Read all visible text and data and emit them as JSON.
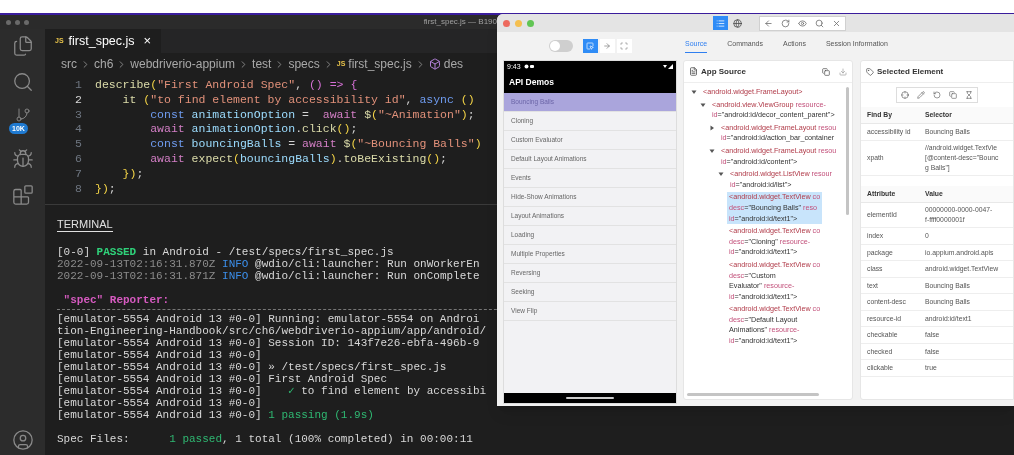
{
  "vscode": {
    "title": "first_spec.js — B190",
    "source_control_badge": "10K",
    "tab": {
      "file_icon": "JS",
      "label": "first_spec.js",
      "close": "×",
      "selected": true
    },
    "breadcrumb": [
      {
        "label": "src",
        "kind": "folder"
      },
      {
        "label": "ch6",
        "kind": "folder"
      },
      {
        "label": "webdriverio-appium",
        "kind": "folder"
      },
      {
        "label": "test",
        "kind": "folder"
      },
      {
        "label": "specs",
        "kind": "folder"
      },
      {
        "label": "first_spec.js",
        "kind": "file",
        "icon_text": "JS"
      },
      {
        "label": "des",
        "kind": "symbol"
      }
    ],
    "code": [
      {
        "number": "1",
        "current": false,
        "tokens": [
          {
            "text": "describe",
            "kind": "fn"
          },
          {
            "text": "(",
            "kind": "br"
          },
          {
            "text": "\"First Android Spec\"",
            "kind": "str"
          },
          {
            "text": ", ",
            "kind": "p"
          },
          {
            "text": "() => {",
            "kind": "arrow"
          }
        ]
      },
      {
        "number": "2",
        "current": true,
        "tokens": [
          {
            "text": "    it",
            "kind": "fn"
          },
          {
            "text": " (",
            "kind": "br"
          },
          {
            "text": "\"to find element by accessibility id\"",
            "kind": "str"
          },
          {
            "text": ", ",
            "kind": "p"
          },
          {
            "text": "async",
            "kind": "kw"
          },
          {
            "text": " ()",
            "kind": "br"
          }
        ]
      },
      {
        "number": "3",
        "current": false,
        "tokens": [
          {
            "text": "        const",
            "kind": "kw"
          },
          {
            "text": " animationOption",
            "kind": "var"
          },
          {
            "text": " =  ",
            "kind": "p"
          },
          {
            "text": "await",
            "kind": "aw"
          },
          {
            "text": " $",
            "kind": "fn"
          },
          {
            "text": "(",
            "kind": "br"
          },
          {
            "text": "\"~Animation\"",
            "kind": "str"
          },
          {
            "text": ")",
            "kind": "br"
          },
          {
            "text": ";",
            "kind": "p"
          }
        ]
      },
      {
        "number": "4",
        "current": false,
        "tokens": [
          {
            "text": "        await",
            "kind": "aw"
          },
          {
            "text": " animationOption",
            "kind": "var"
          },
          {
            "text": ".",
            "kind": "p"
          },
          {
            "text": "click",
            "kind": "fn"
          },
          {
            "text": "()",
            "kind": "br"
          },
          {
            "text": ";",
            "kind": "p"
          }
        ]
      },
      {
        "number": "5",
        "current": false,
        "tokens": [
          {
            "text": "        const",
            "kind": "kw"
          },
          {
            "text": " bouncingBalls",
            "kind": "var"
          },
          {
            "text": " = ",
            "kind": "p"
          },
          {
            "text": "await",
            "kind": "aw"
          },
          {
            "text": " $",
            "kind": "fn"
          },
          {
            "text": "(",
            "kind": "br"
          },
          {
            "text": "\"~Bouncing Balls\"",
            "kind": "str"
          },
          {
            "text": ")",
            "kind": "br"
          }
        ]
      },
      {
        "number": "6",
        "current": false,
        "tokens": [
          {
            "text": "        await",
            "kind": "aw"
          },
          {
            "text": " expect",
            "kind": "fn"
          },
          {
            "text": "(",
            "kind": "br"
          },
          {
            "text": "bouncingBalls",
            "kind": "var"
          },
          {
            "text": ")",
            "kind": "br"
          },
          {
            "text": ".",
            "kind": "p"
          },
          {
            "text": "toBeExisting",
            "kind": "fn"
          },
          {
            "text": "()",
            "kind": "br"
          },
          {
            "text": ";",
            "kind": "p"
          }
        ]
      },
      {
        "number": "7",
        "current": false,
        "tokens": [
          {
            "text": "    })",
            "kind": "br"
          },
          {
            "text": ";",
            "kind": "p"
          }
        ]
      },
      {
        "number": "8",
        "current": false,
        "tokens": [
          {
            "text": "})",
            "kind": "br"
          },
          {
            "text": ";",
            "kind": "p"
          }
        ]
      }
    ],
    "panel_title": "TERMINAL",
    "terminal": [
      {
        "lines": [
          [
            {
              "text": "[0-0] ",
              "kind": "plain"
            },
            {
              "text": "PASSED",
              "kind": "pass"
            },
            {
              "text": " in Android - /test/specs/first_spec.js",
              "kind": "plain"
            }
          ],
          [
            {
              "text": "2022-09-13T02:16:31.870Z",
              "kind": "dim"
            },
            {
              "text": " INFO",
              "kind": "info"
            },
            {
              "text": " @wdio/cli:launcher: Run onWorkerEn",
              "kind": "plain"
            }
          ],
          [
            {
              "text": "2022-09-13T02:16:31.871Z",
              "kind": "dim"
            },
            {
              "text": " INFO",
              "kind": "info"
            },
            {
              "text": " @wdio/cli:launcher: Run onComplete",
              "kind": "plain"
            }
          ]
        ]
      },
      {
        "title": " \"spec\" Reporter:",
        "lines": [
          [
            {
              "text": "[emulator-5554 Android 13 #0-0] Running: emulator-5554 on Androi",
              "kind": "plain"
            }
          ],
          [
            {
              "text": "tion-Engineering-Handbook/src/ch6/webdriverio-appium/app/android/",
              "kind": "plain"
            }
          ],
          [
            {
              "text": "[emulator-5554 Android 13 #0-0] Session ID: 143f7e26-ebfa-496b-9",
              "kind": "plain"
            }
          ],
          [
            {
              "text": "[emulator-5554 Android 13 #0-0]",
              "kind": "plain"
            }
          ],
          [
            {
              "text": "[emulator-5554 Android 13 #0-0] » /test/specs/first_spec.js",
              "kind": "plain"
            }
          ],
          [
            {
              "text": "[emulator-5554 Android 13 #0-0] First Android Spec",
              "kind": "plain"
            }
          ],
          [
            {
              "text": "[emulator-5554 Android 13 #0-0]    ",
              "kind": "plain"
            },
            {
              "text": "✓",
              "kind": "ok"
            },
            {
              "text": " to find element by accessibi",
              "kind": "plain"
            }
          ],
          [
            {
              "text": "[emulator-5554 Android 13 #0-0]",
              "kind": "plain"
            }
          ],
          [
            {
              "text": "[emulator-5554 Android 13 #0-0] ",
              "kind": "plain"
            },
            {
              "text": "1 passing (1.9s)",
              "kind": "ok"
            }
          ]
        ]
      },
      {
        "lines": [
          [
            {
              "text": "Spec Files:      ",
              "kind": "plain"
            },
            {
              "text": "1 passed",
              "kind": "ok"
            },
            {
              "text": ", 1 total (100% completed) in 00:00:11",
              "kind": "plain"
            }
          ]
        ]
      }
    ]
  },
  "inspector": {
    "app_modes": [
      {
        "selected": true
      },
      {
        "selected": false
      }
    ],
    "toggle_on": false,
    "interaction_modes": [
      {
        "selected": true
      },
      {
        "selected": false
      },
      {
        "selected": false
      }
    ],
    "device": {
      "time": "9:43",
      "app_title": "API Demos",
      "items": [
        {
          "label": "Bouncing Balls",
          "selected": true
        },
        {
          "label": "Cloning",
          "selected": false
        },
        {
          "label": "Custom Evaluator",
          "selected": false
        },
        {
          "label": "Default Layout Animations",
          "selected": false
        },
        {
          "label": "Events",
          "selected": false
        },
        {
          "label": "Hide-Show Animations",
          "selected": false
        },
        {
          "label": "Layout Animations",
          "selected": false
        },
        {
          "label": "Loading",
          "selected": false
        },
        {
          "label": "Multiple Properties",
          "selected": false
        },
        {
          "label": "Reversing",
          "selected": false
        },
        {
          "label": "Seeking",
          "selected": false
        },
        {
          "label": "View Flip",
          "selected": false
        }
      ]
    },
    "tabs": [
      {
        "label": "Source",
        "selected": true
      },
      {
        "label": "Commands",
        "selected": false
      },
      {
        "label": "Actions",
        "selected": false
      },
      {
        "label": "Session Information",
        "selected": false
      }
    ],
    "source": {
      "title": "App Source",
      "tree": [
        {
          "expanded": true,
          "selected": false,
          "lines": [
            [
              {
                "text": "<android.widget.FrameLayout>",
                "kind": "tag"
              }
            ]
          ],
          "children": [
            {
              "expanded": true,
              "selected": false,
              "lines": [
                [
                  {
                    "text": "<android.view.ViewGroup",
                    "kind": "tag"
                  },
                  {
                    "text": " resource-",
                    "kind": "attr"
                  }
                ],
                [
                  {
                    "text": "id",
                    "kind": "attr"
                  },
                  {
                    "text": "=\"android:id/decor_content_parent\">",
                    "kind": "val"
                  }
                ]
              ],
              "children": [
                {
                  "expanded": false,
                  "selected": false,
                  "lines": [
                    [
                      {
                        "text": "<android.widget.FrameLayout",
                        "kind": "tag"
                      },
                      {
                        "text": " resou",
                        "kind": "attr"
                      }
                    ],
                    [
                      {
                        "text": "id",
                        "kind": "attr"
                      },
                      {
                        "text": "=\"android:id/action_bar_container",
                        "kind": "val"
                      }
                    ]
                  ]
                },
                {
                  "expanded": true,
                  "selected": false,
                  "lines": [
                    [
                      {
                        "text": "<android.widget.FrameLayout",
                        "kind": "tag"
                      },
                      {
                        "text": " resou",
                        "kind": "attr"
                      }
                    ],
                    [
                      {
                        "text": "id",
                        "kind": "attr"
                      },
                      {
                        "text": "=\"android:id/content\">",
                        "kind": "val"
                      }
                    ]
                  ],
                  "children": [
                    {
                      "expanded": true,
                      "selected": false,
                      "lines": [
                        [
                          {
                            "text": "<android.widget.ListView",
                            "kind": "tag"
                          },
                          {
                            "text": " resour",
                            "kind": "attr"
                          }
                        ],
                        [
                          {
                            "text": "id",
                            "kind": "attr"
                          },
                          {
                            "text": "=\"android:id/list\">",
                            "kind": "val"
                          }
                        ]
                      ],
                      "children": [
                        {
                          "selected": true,
                          "lines": [
                            [
                              {
                                "text": "<android.widget.TextView",
                                "kind": "tag"
                              },
                              {
                                "text": " co",
                                "kind": "attr"
                              }
                            ],
                            [
                              {
                                "text": "desc",
                                "kind": "attr"
                              },
                              {
                                "text": "=\"Bouncing Balls\"",
                                "kind": "val"
                              },
                              {
                                "text": " reso",
                                "kind": "attr"
                              }
                            ],
                            [
                              {
                                "text": "id",
                                "kind": "attr"
                              },
                              {
                                "text": "=\"android:id/text1\">",
                                "kind": "val"
                              }
                            ]
                          ]
                        },
                        {
                          "selected": false,
                          "lines": [
                            [
                              {
                                "text": "<android.widget.TextView",
                                "kind": "tag"
                              },
                              {
                                "text": " co",
                                "kind": "attr"
                              }
                            ],
                            [
                              {
                                "text": "desc",
                                "kind": "attr"
                              },
                              {
                                "text": "=\"Cloning\"",
                                "kind": "val"
                              },
                              {
                                "text": " resource-",
                                "kind": "attr"
                              }
                            ],
                            [
                              {
                                "text": "id",
                                "kind": "attr"
                              },
                              {
                                "text": "=\"android:id/text1\">",
                                "kind": "val"
                              }
                            ]
                          ]
                        },
                        {
                          "selected": false,
                          "lines": [
                            [
                              {
                                "text": "<android.widget.TextView",
                                "kind": "tag"
                              },
                              {
                                "text": " co",
                                "kind": "attr"
                              }
                            ],
                            [
                              {
                                "text": "desc",
                                "kind": "attr"
                              },
                              {
                                "text": "=\"Custom",
                                "kind": "val"
                              }
                            ],
                            [
                              {
                                "text": "Evaluator\"",
                                "kind": "val"
                              },
                              {
                                "text": " resource-",
                                "kind": "attr"
                              }
                            ],
                            [
                              {
                                "text": "id",
                                "kind": "attr"
                              },
                              {
                                "text": "=\"android:id/text1\">",
                                "kind": "val"
                              }
                            ]
                          ]
                        },
                        {
                          "selected": false,
                          "lines": [
                            [
                              {
                                "text": "<android.widget.TextView",
                                "kind": "tag"
                              },
                              {
                                "text": " co",
                                "kind": "attr"
                              }
                            ],
                            [
                              {
                                "text": "desc",
                                "kind": "attr"
                              },
                              {
                                "text": "=\"Default Layout",
                                "kind": "val"
                              }
                            ],
                            [
                              {
                                "text": "Animations\"",
                                "kind": "val"
                              },
                              {
                                "text": " resource-",
                                "kind": "attr"
                              }
                            ],
                            [
                              {
                                "text": "id",
                                "kind": "attr"
                              },
                              {
                                "text": "=\"android:id/text1\">",
                                "kind": "val"
                              }
                            ]
                          ]
                        }
                      ]
                    }
                  ]
                }
              ]
            }
          ]
        }
      ]
    },
    "selected_element": {
      "title": "Selected Element",
      "find_by": {
        "columns": [
          "Find By",
          "Selector"
        ],
        "rows": [
          {
            "name": "accessibility id",
            "value": [
              "Bouncing Balls"
            ]
          },
          {
            "name": "xpath",
            "value": [
              "//android.widget.TextVie",
              "[@content-desc=\"Bounc",
              "g Balls\"]"
            ]
          }
        ]
      },
      "attributes": {
        "columns": [
          "Attribute",
          "Value"
        ],
        "rows": [
          {
            "name": "elementId",
            "value": [
              "00000000-0000-0047-",
              "f-ffff0000001f"
            ]
          },
          {
            "name": "index",
            "value": [
              "0"
            ]
          },
          {
            "name": "package",
            "value": [
              "io.appium.android.apis"
            ]
          },
          {
            "name": "class",
            "value": [
              "android.widget.TextView"
            ]
          },
          {
            "name": "text",
            "value": [
              "Bouncing Balls"
            ]
          },
          {
            "name": "content-desc",
            "value": [
              "Bouncing Balls"
            ]
          },
          {
            "name": "resource-id",
            "value": [
              "android:id/text1"
            ]
          },
          {
            "name": "checkable",
            "value": [
              "false"
            ]
          },
          {
            "name": "checked",
            "value": [
              "false"
            ]
          },
          {
            "name": "clickable",
            "value": [
              "true"
            ]
          }
        ]
      }
    }
  }
}
